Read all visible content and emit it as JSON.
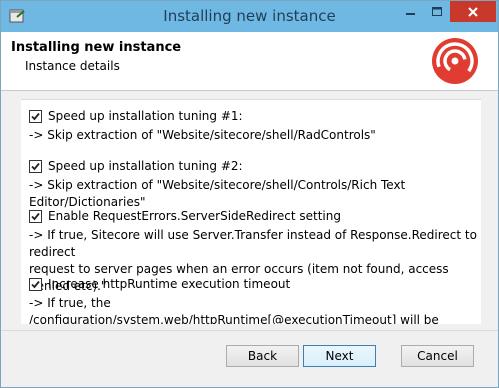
{
  "window": {
    "title": "Installing new instance"
  },
  "header": {
    "title": "Installing new instance",
    "subtitle": "Instance details",
    "logo_icon": "sitecore-logo-icon"
  },
  "options": [
    {
      "label": "Speed up installation tuning #1:",
      "description": "-> Skip extraction of \"Website/sitecore/shell/RadControls\"",
      "checked": true
    },
    {
      "label": "Speed up installation tuning #2:",
      "description": "-> Skip extraction of \"Website/sitecore/shell/Controls/Rich Text Editor/Dictionaries\"",
      "checked": true
    },
    {
      "label": "Enable RequestErrors.ServerSideRedirect setting",
      "description": "-> If true, Sitecore will use Server.Transfer instead of Response.Redirect to redirect\nrequest to server pages when an error occurs (item not found, access denied etc).\"",
      "checked": true
    },
    {
      "label": "Increase httpRuntime execution timeout",
      "description": "-> If true, the /configuration/system.web/httpRuntime[@executionTimeout] will be",
      "checked": true
    }
  ],
  "footer": {
    "back_label": "Back",
    "next_label": "Next",
    "cancel_label": "Cancel"
  },
  "colors": {
    "titlebar": "#70b8e4",
    "close_button": "#c8392b",
    "logo_red": "#e03c31"
  }
}
